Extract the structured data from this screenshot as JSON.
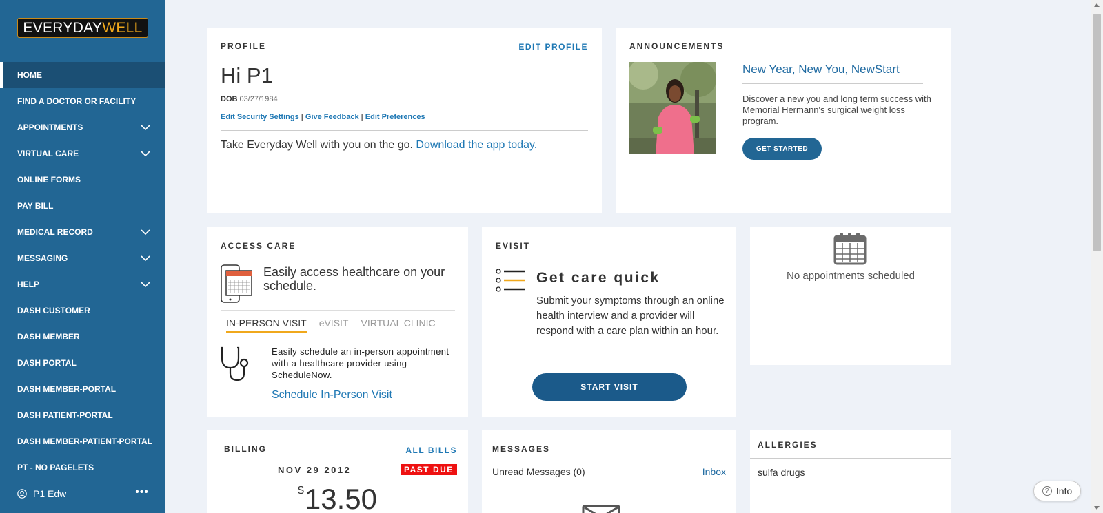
{
  "brand": {
    "logo_part1": "EVERYDAY",
    "logo_part2": "WELL"
  },
  "sidebar": {
    "items": [
      {
        "label": "HOME",
        "active": true,
        "expandable": false
      },
      {
        "label": "FIND A DOCTOR OR FACILITY",
        "expandable": false
      },
      {
        "label": "APPOINTMENTS",
        "expandable": true
      },
      {
        "label": "VIRTUAL CARE",
        "expandable": true
      },
      {
        "label": "ONLINE FORMS",
        "expandable": false
      },
      {
        "label": "PAY BILL",
        "expandable": false
      },
      {
        "label": "MEDICAL RECORD",
        "expandable": true
      },
      {
        "label": "MESSAGING",
        "expandable": true
      },
      {
        "label": "HELP",
        "expandable": true
      },
      {
        "label": "DASH CUSTOMER",
        "expandable": false
      },
      {
        "label": "DASH MEMBER",
        "expandable": false
      },
      {
        "label": "DASH PORTAL",
        "expandable": false
      },
      {
        "label": "DASH MEMBER-PORTAL",
        "expandable": false
      },
      {
        "label": "DASH PATIENT-PORTAL",
        "expandable": false
      },
      {
        "label": "DASH MEMBER-PATIENT-PORTAL",
        "expandable": false
      },
      {
        "label": "PT - NO PAGELETS",
        "expandable": false
      }
    ],
    "user": {
      "name": "P1 Edw",
      "more": "•••"
    }
  },
  "profile": {
    "title": "PROFILE",
    "edit_label": "EDIT PROFILE",
    "greeting": "Hi P1",
    "dob_label": "DOB",
    "dob_value": "03/27/1984",
    "links": [
      "Edit Security Settings",
      "Give Feedback",
      "Edit Preferences"
    ],
    "separator": "|",
    "promo_text": "Take Everyday Well with you on the go. ",
    "promo_link": "Download the app today."
  },
  "announcements": {
    "title": "ANNOUNCEMENTS",
    "headline": "New Year, New You, NewStart",
    "body": "Discover a new you and long term success with Memorial Hermann's surgical weight loss program.",
    "button": "GET STARTED"
  },
  "access_care": {
    "title": "ACCESS CARE",
    "heading": "Easily access healthcare on your schedule.",
    "tabs": [
      {
        "label": "IN-PERSON VISIT",
        "active": true
      },
      {
        "label": "eVISIT",
        "active": false
      },
      {
        "label": "VIRTUAL CLINIC",
        "active": false
      }
    ],
    "description": "Easily schedule an in-person appointment with a healthcare provider using ScheduleNow.",
    "link": "Schedule In-Person Visit"
  },
  "evisit": {
    "title": "EVISIT",
    "heading": "Get care quick",
    "description": "Submit your symptoms through an online health interview and a provider will respond with a care plan within an hour.",
    "button": "START VISIT"
  },
  "appointments": {
    "empty_text": "No appointments scheduled"
  },
  "billing": {
    "title": "BILLING",
    "all_bills": "ALL BILLS",
    "date": "NOV 29 2012",
    "status": "PAST DUE",
    "currency": "$",
    "amount": "13.50"
  },
  "messages": {
    "title": "MESSAGES",
    "unread_label": "Unread Messages (0)",
    "inbox": "Inbox"
  },
  "allergies": {
    "title": "ALLERGIES",
    "items": [
      "sulfa drugs"
    ]
  },
  "info_button": {
    "label": "Info",
    "icon": "?"
  },
  "colors": {
    "sidebar": "#226694",
    "sidebar_active": "#1b4f74",
    "accent_gold": "#f0a81c",
    "link_blue": "#1f78b4",
    "past_due_red": "#e11111",
    "page_bg": "#eef2f8"
  }
}
